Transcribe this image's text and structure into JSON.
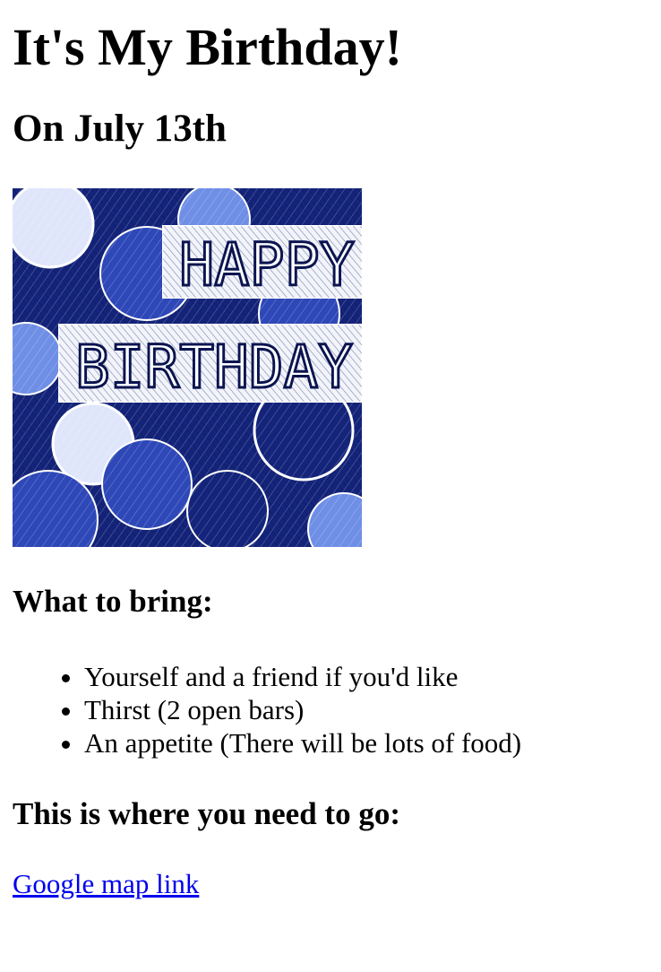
{
  "page": {
    "title": "It's My Birthday!",
    "subtitle": "On July 13th"
  },
  "image": {
    "line1": "HAPPY",
    "line2": "BIRTHDAY"
  },
  "bring": {
    "heading": "What to bring:",
    "items": [
      "Yourself and a friend if you'd like",
      "Thirst (2 open bars)",
      "An appetite (There will be lots of food)"
    ]
  },
  "location": {
    "heading": "This is where you need to go:",
    "link_label": "Google map link"
  },
  "colors": {
    "link": "#0000ee",
    "image_dark_blue": "#14247a",
    "image_mid_blue": "#2e48b8",
    "image_light_blue": "#6f8fe6"
  }
}
